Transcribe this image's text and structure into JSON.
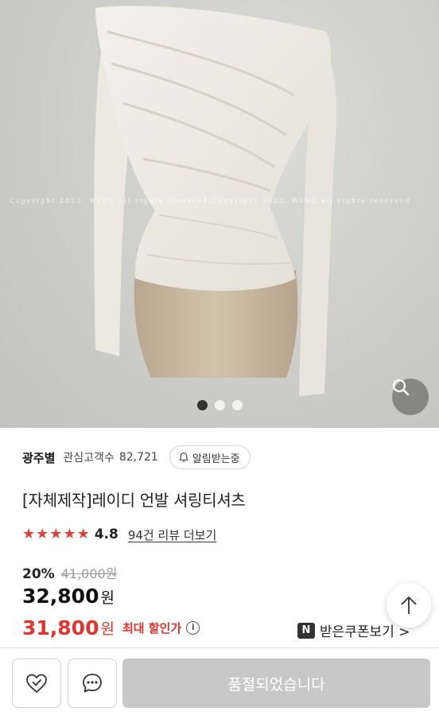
{
  "gallery": {
    "watermark": "Copyright 2023. WINC all rights reserved    Copyright 2023. WINC all rights reserved",
    "pages": 3,
    "current_page": 1,
    "zoom_icon": "search-icon"
  },
  "seller": {
    "name": "광주별",
    "fav_label": "관심고객수",
    "fav_count": "82,721",
    "alarm_label": "알림받는중",
    "alarm_icon": "bell-icon"
  },
  "product": {
    "title": "[자체제작]레이디 언발 셔링티셔츠",
    "rating": "4.8",
    "stars": 5,
    "review_link": "94건 리뷰 더보기",
    "star_color": "#e0413f"
  },
  "price": {
    "discount": "20%",
    "original": "41,000원",
    "sale_number": "32,800",
    "sale_unit": "원",
    "coupon_number": "31,800",
    "coupon_unit": "원",
    "max_discount_label": "최대 할인가",
    "info_icon": "i",
    "accent_color": "#e2342f"
  },
  "coupon": {
    "logo": "N",
    "label": "받은쿠폰보기 >"
  },
  "bottom_bar": {
    "wishlist_icon": "heart-check-icon",
    "chat_icon": "chat-bubble-icon",
    "soldout_label": "품절되었습니다"
  }
}
